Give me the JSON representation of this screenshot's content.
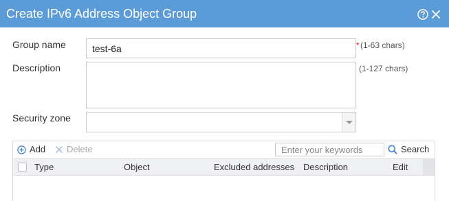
{
  "dialog": {
    "title": "Create IPv6 Address Object Group",
    "help_icon": "question-circle-icon",
    "close_icon": "close-icon"
  },
  "form": {
    "group_name": {
      "label": "Group name",
      "value": "test-6a",
      "required_mark": "*",
      "hint": "(1-63 chars)"
    },
    "description": {
      "label": "Description",
      "value": "",
      "hint": "(1-127 chars)"
    },
    "security_zone": {
      "label": "Security zone",
      "value": ""
    }
  },
  "toolbar": {
    "add_label": "Add",
    "delete_label": "Delete",
    "search_placeholder": "Enter your keywords",
    "search_label": "Search"
  },
  "table": {
    "columns": [
      "Type",
      "Object",
      "Excluded addresses",
      "Description",
      "Edit"
    ],
    "rows": []
  },
  "colors": {
    "title_bar": "#5b9bd8",
    "required": "#e02020",
    "add_icon": "#3a7fc8",
    "delete_disabled": "#aaaaaa"
  }
}
